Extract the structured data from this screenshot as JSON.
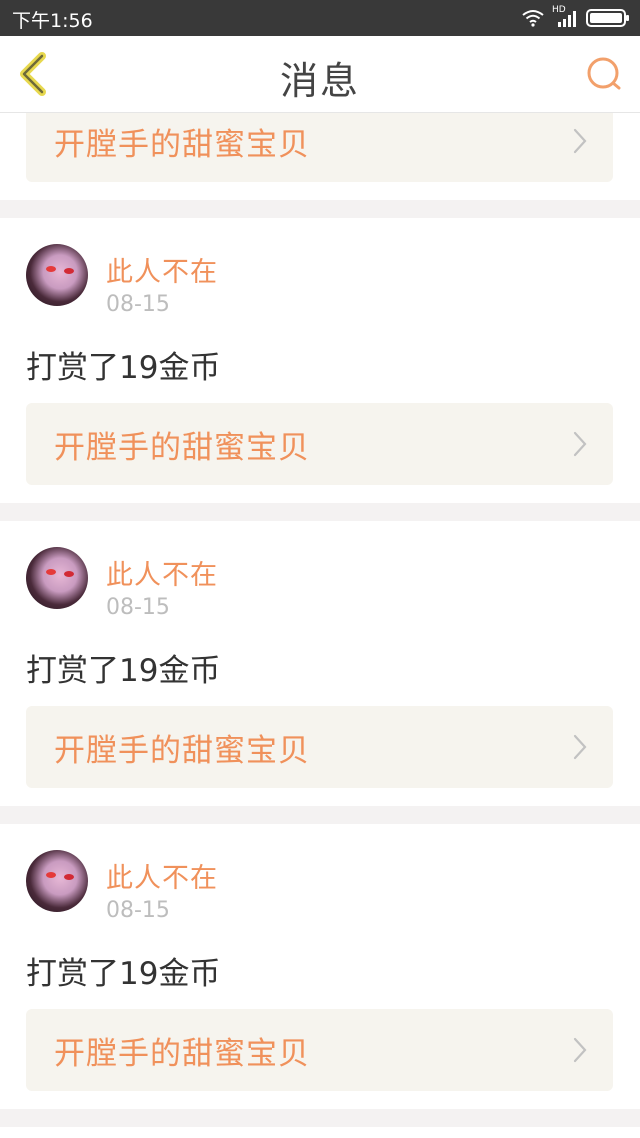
{
  "status": {
    "time": "下午1:56",
    "network": "HD"
  },
  "nav": {
    "title": "消息"
  },
  "colors": {
    "accent": "#f0915b",
    "back_icon": "#e7d84e",
    "background": "#f4f2f2",
    "card": "#ffffff"
  },
  "top_partial": {
    "post_title": "开膛手的甜蜜宝贝"
  },
  "messages": [
    {
      "user": "此人不在",
      "date": "08-15",
      "text": "打赏了19金币",
      "post_title": "开膛手的甜蜜宝贝"
    },
    {
      "user": "此人不在",
      "date": "08-15",
      "text": "打赏了19金币",
      "post_title": "开膛手的甜蜜宝贝"
    },
    {
      "user": "此人不在",
      "date": "08-15",
      "text": "打赏了19金币",
      "post_title": "开膛手的甜蜜宝贝"
    }
  ]
}
